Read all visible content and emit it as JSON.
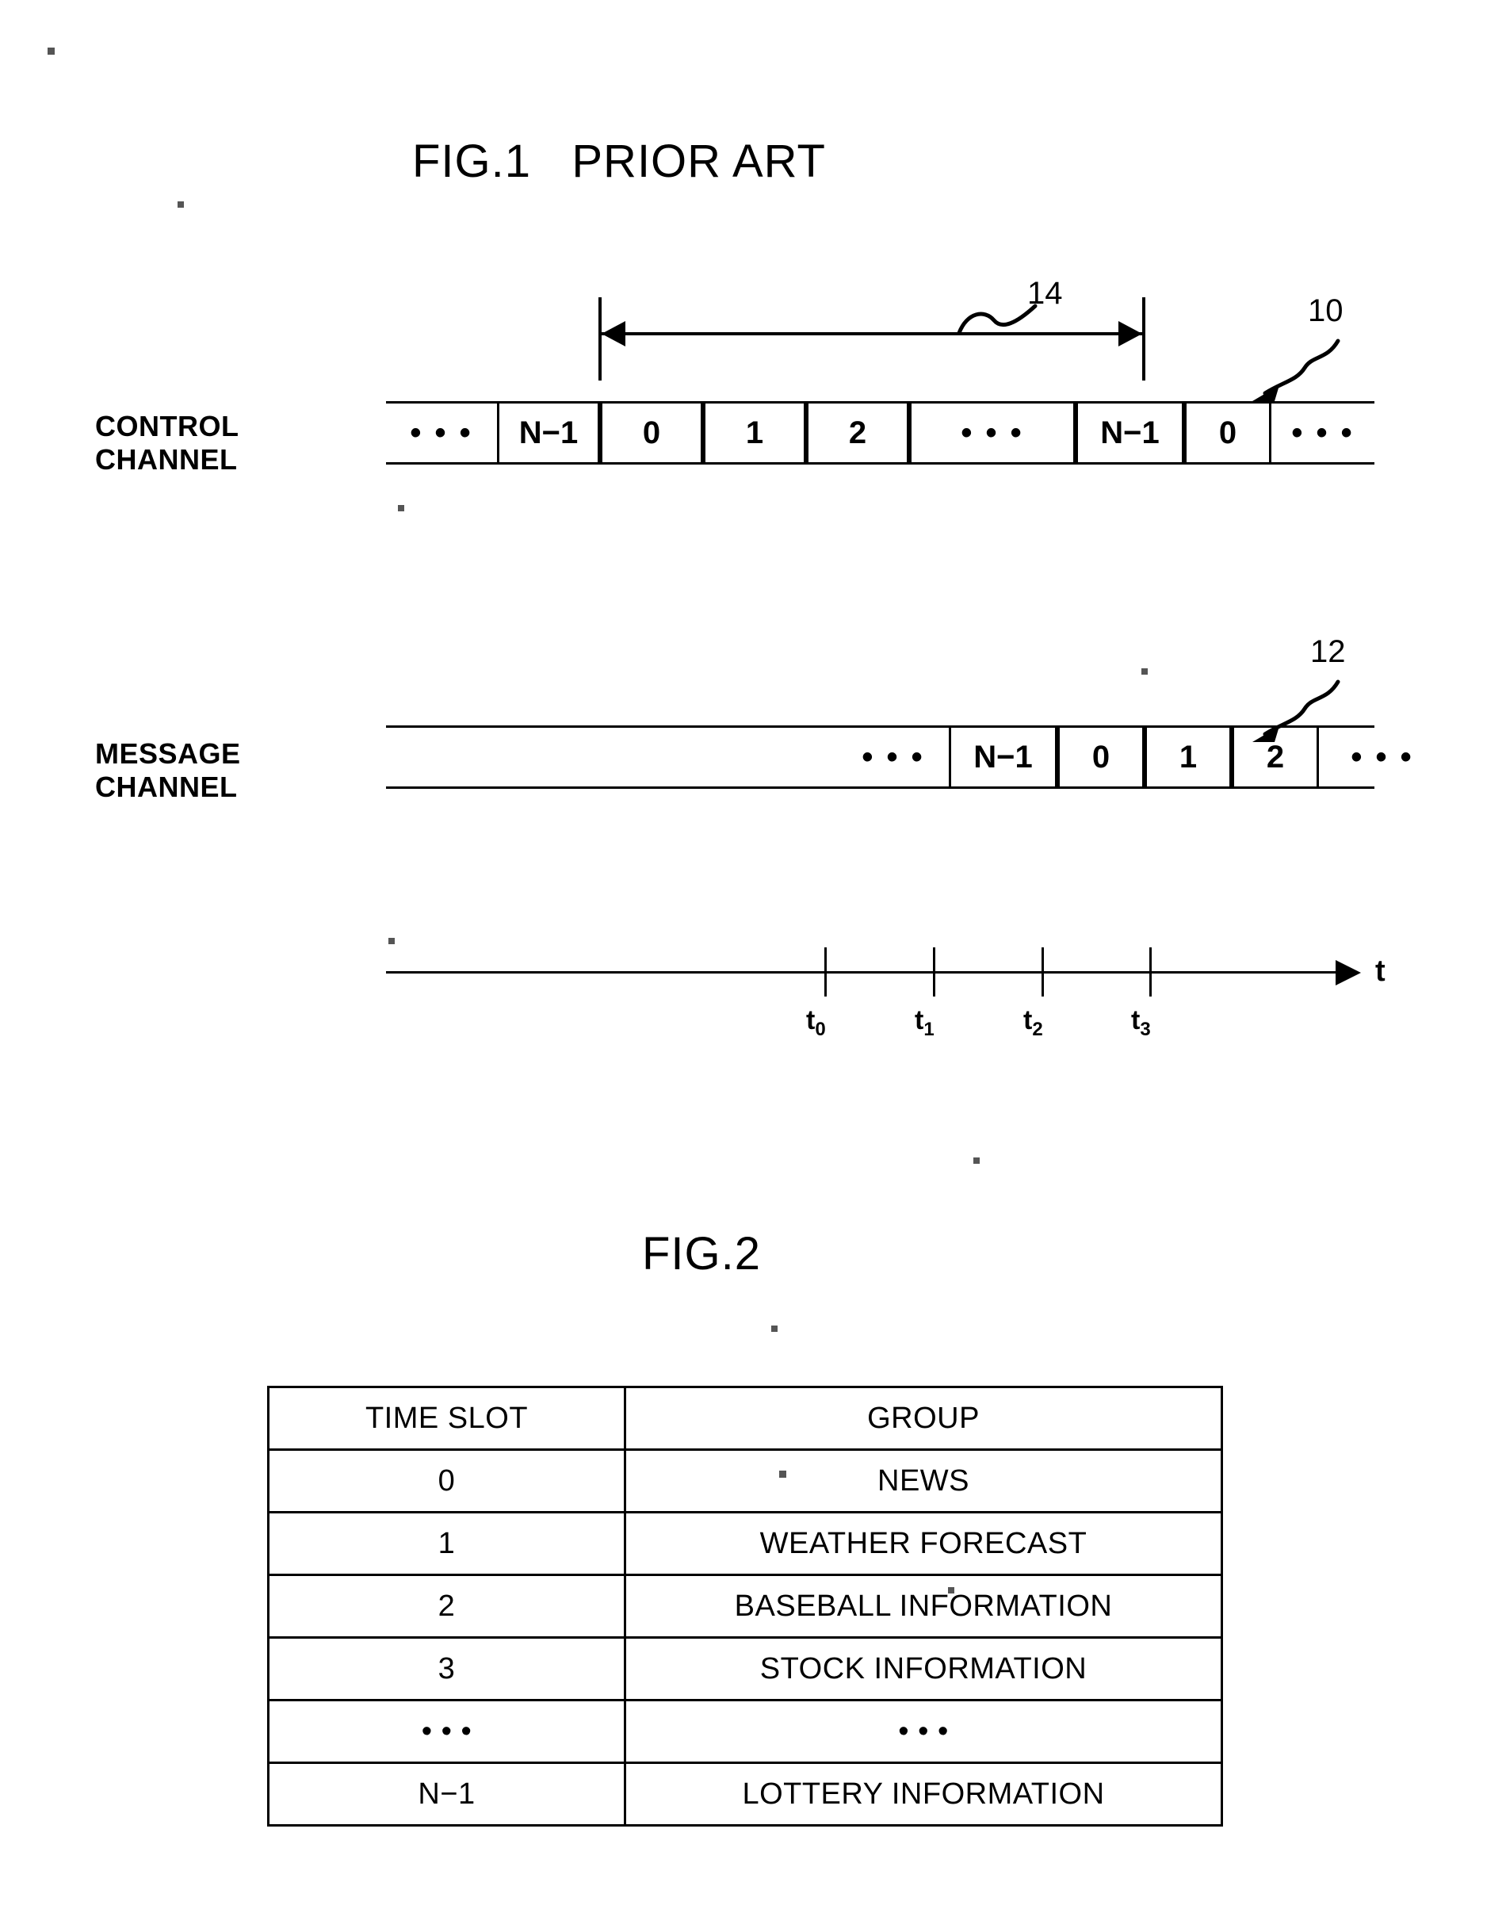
{
  "figures": {
    "fig1": {
      "title": "FIG.1   PRIOR ART",
      "control_channel_label": "CONTROL\nCHANNEL",
      "message_channel_label": "MESSAGE\nCHANNEL",
      "control_cells": [
        "• • •",
        "N−1",
        "0",
        "1",
        "2",
        "• • •",
        "N−1",
        "0",
        "• • •"
      ],
      "message_cells": [
        "• • •",
        "N−1",
        "0",
        "1",
        "2",
        "• • •"
      ],
      "ref_frame": "14",
      "ref_control": "10",
      "ref_message": "12",
      "axis_label": "t",
      "tick_labels": [
        "t0",
        "t1",
        "t2",
        "t3"
      ]
    },
    "fig2": {
      "title": "FIG.2",
      "table": {
        "headers": [
          "TIME SLOT",
          "GROUP"
        ],
        "rows": [
          [
            "0",
            "NEWS"
          ],
          [
            "1",
            "WEATHER FORECAST"
          ],
          [
            "2",
            "BASEBALL INFORMATION"
          ],
          [
            "3",
            "STOCK INFORMATION"
          ],
          [
            "• • •",
            "• • •"
          ],
          [
            "N−1",
            "LOTTERY INFORMATION"
          ]
        ]
      }
    }
  }
}
